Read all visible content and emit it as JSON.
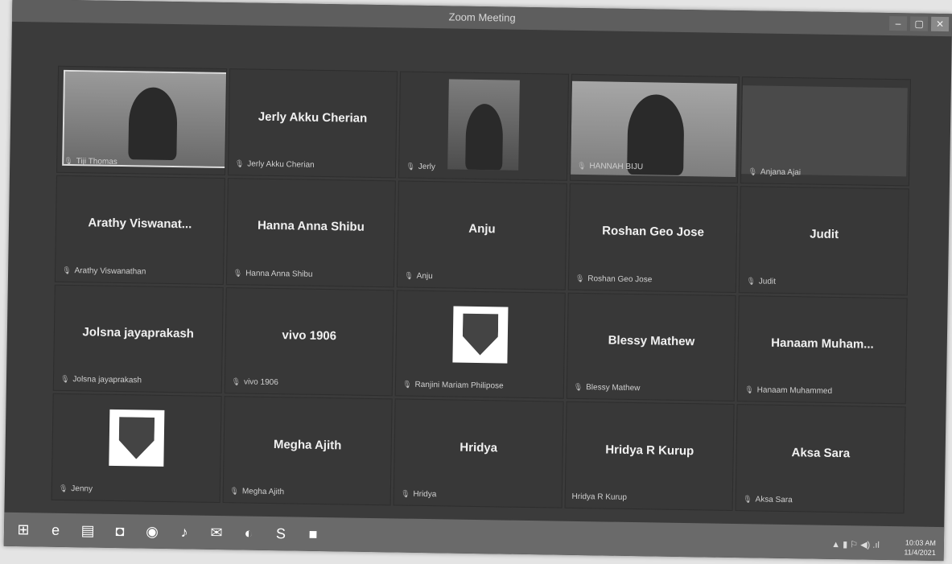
{
  "window": {
    "title": "Zoom Meeting",
    "minimize": "–",
    "maximize": "▢",
    "close": "✕"
  },
  "tiles": [
    {
      "display_name": "",
      "name": "Tiji Thomas",
      "type": "video"
    },
    {
      "display_name": "Jerly Akku Cherian",
      "name": "Jerly Akku Cherian",
      "type": "text"
    },
    {
      "display_name": "",
      "name": "Jerly",
      "type": "video"
    },
    {
      "display_name": "",
      "name": "HANNAH BIJU",
      "type": "video"
    },
    {
      "display_name": "",
      "name": "Anjana Ajai",
      "type": "video"
    },
    {
      "display_name": "Arathy Viswanat...",
      "name": "Arathy Viswanathan",
      "type": "text"
    },
    {
      "display_name": "Hanna Anna Shibu",
      "name": "Hanna Anna Shibu",
      "type": "text"
    },
    {
      "display_name": "Anju",
      "name": "Anju",
      "type": "text"
    },
    {
      "display_name": "Roshan Geo Jose",
      "name": "Roshan Geo Jose",
      "type": "text"
    },
    {
      "display_name": "Judit",
      "name": "Judit",
      "type": "text"
    },
    {
      "display_name": "Jolsna jayaprakash",
      "name": "Jolsna jayaprakash",
      "type": "text"
    },
    {
      "display_name": "vivo 1906",
      "name": "vivo 1906",
      "type": "text"
    },
    {
      "display_name": "",
      "name": "Ranjini Mariam Philipose",
      "type": "logo"
    },
    {
      "display_name": "Blessy Mathew",
      "name": "Blessy Mathew",
      "type": "text"
    },
    {
      "display_name": "Hanaam Muham...",
      "name": "Hanaam Muhammed",
      "type": "text"
    },
    {
      "display_name": "",
      "name": "Jenny",
      "type": "logo"
    },
    {
      "display_name": "Megha Ajith",
      "name": "Megha Ajith",
      "type": "text"
    },
    {
      "display_name": "Hridya",
      "name": "Hridya",
      "type": "text"
    },
    {
      "display_name": "Hridya R Kurup",
      "name": "Hridya R Kurup",
      "type": "text"
    },
    {
      "display_name": "Aksa Sara",
      "name": "Aksa Sara",
      "type": "text"
    }
  ],
  "taskbar": {
    "icons": [
      "start-icon",
      "internet-explorer-icon",
      "file-explorer-icon",
      "store-icon",
      "app-icon",
      "app2-icon",
      "mail-icon",
      "media-icon",
      "skype-icon",
      "zoom-icon"
    ],
    "glyphs": [
      "⊞",
      "e",
      "▤",
      "◘",
      "◉",
      "♪",
      "✉",
      "◐",
      "S",
      "■"
    ],
    "time": "10:03 AM",
    "date": "11/4/2021",
    "tray_icons": "▲ ▮ ⚐ ◀) .ıl"
  }
}
